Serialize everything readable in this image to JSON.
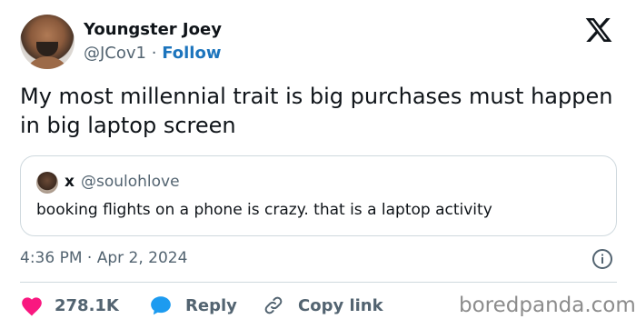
{
  "author": {
    "display_name": "Youngster Joey",
    "handle": "@JCov1",
    "separator": "·",
    "follow_label": "Follow"
  },
  "tweet": {
    "text": "My most millennial trait is big purchases must happen in big laptop screen"
  },
  "quoted": {
    "name": "x",
    "handle": "@soulohlove",
    "text": "booking flights on a phone is crazy. that is a laptop activity"
  },
  "meta": {
    "timestamp": "4:36 PM · Apr 2, 2024"
  },
  "actions": {
    "likes_count": "278.1K",
    "reply_label": "Reply",
    "copy_link_label": "Copy link"
  },
  "watermark": "boredpanda.com",
  "colors": {
    "accent": "#1d75bd",
    "like": "#f91880",
    "reply_bubble": "#1d9bf0",
    "muted": "#536471",
    "border": "#cfd9de"
  },
  "icons": {
    "brand": "x-logo-icon",
    "info": "info-icon",
    "like": "heart-icon",
    "reply": "speech-bubble-icon",
    "copy": "link-icon"
  }
}
